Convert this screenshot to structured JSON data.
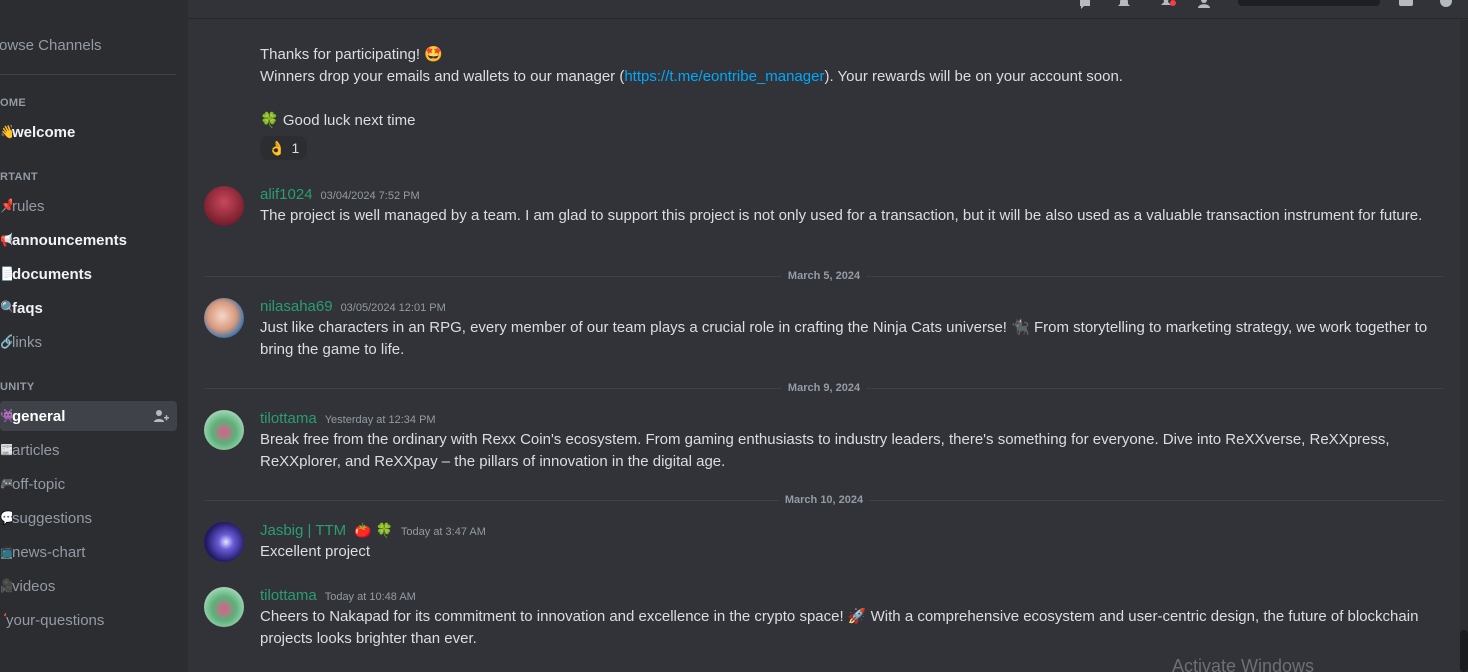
{
  "sidebar": {
    "browse_label": "rowse Channels",
    "categories": [
      "OME",
      "RTANT",
      "UNITY"
    ],
    "channels": [
      {
        "icon": "👋",
        "name": "welcome"
      },
      {
        "icon": "📌",
        "name": "rules"
      },
      {
        "icon": "📢",
        "name": "announcements"
      },
      {
        "icon": "📄",
        "name": "documents"
      },
      {
        "icon": "🔍",
        "name": "faqs"
      },
      {
        "icon": "🔗",
        "name": "links"
      },
      {
        "icon": "👾",
        "name": "general"
      },
      {
        "icon": "📰",
        "name": "articles"
      },
      {
        "icon": "🎮",
        "name": "off-topic"
      },
      {
        "icon": "💬",
        "name": "suggestions"
      },
      {
        "icon": "📺",
        "name": "news-chart"
      },
      {
        "icon": "🎥",
        "name": "videos"
      },
      {
        "icon": "❓",
        "name": "your-questions"
      }
    ]
  },
  "top_message": {
    "line1": "Thanks for participating! 🤩",
    "line2_before": "Winners drop your emails and wallets to our manager (",
    "link": "https://t.me/eontribe_manager",
    "line2_after": "). Your rewards will be on your account soon.",
    "line3": "🍀 Good luck next time",
    "reaction_emoji": "👌",
    "reaction_count": "1"
  },
  "messages": [
    {
      "username": "alif1024",
      "timestamp": "03/04/2024 7:52 PM",
      "text": "The project is well managed by a team. I am glad to support this project is not only used for a transaction, but it will be also used as a valuable transaction instrument for future."
    },
    {
      "username": "nilasaha69",
      "timestamp": "03/05/2024 12:01 PM",
      "text": "Just like characters in an RPG, every member of our team plays a crucial role in crafting the Ninja Cats universe! 🐈‍⬛ From storytelling to marketing strategy, we work together to bring the game to life."
    },
    {
      "username": "tilottama",
      "timestamp": "Yesterday at 12:34 PM",
      "text": "Break free from the ordinary with Rexx Coin's ecosystem. From gaming enthusiasts to industry leaders, there's something for everyone. Dive into ReXXverse, ReXXpress, ReXXplorer, and ReXXpay – the pillars of innovation in the digital age."
    },
    {
      "username": "Jasbig | TTM",
      "username_emoji": "🍅 🍀",
      "timestamp": "Today at 3:47 AM",
      "text": "Excellent project"
    },
    {
      "username": "tilottama",
      "timestamp": "Today at 10:48 AM",
      "text": "Cheers to Nakapad for its commitment to innovation and excellence in the crypto space! 🚀 With a comprehensive ecosystem and user-centric design, the future of blockchain projects looks brighter than ever."
    }
  ],
  "date_separators": [
    "March 5, 2024",
    "March 9, 2024",
    "March 10, 2024"
  ],
  "watermark": "Activate Windows",
  "colors": {
    "username": "#2a9e6e",
    "link": "#00a8fc",
    "background": "#313338",
    "sidebar": "#2b2d31"
  }
}
